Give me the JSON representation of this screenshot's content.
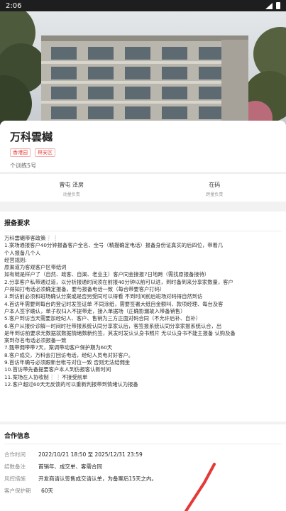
{
  "status_bar": {
    "time": "2:06"
  },
  "project": {
    "title": "万科雲樾",
    "tags": [
      "香港园",
      "林安区"
    ],
    "address": "个训练5号"
  },
  "contacts": [
    {
      "name": "曾屯 泽房",
      "role": "动量负责"
    },
    {
      "name": "在码",
      "role": "跨量负责"
    }
  ],
  "report": {
    "title": "报备要求",
    "lines": [
      "万科雲樾带客政策❕❕",
      "1.案场通报客户40分钟报备客户全名、全号（精描确定电话）报备身份证真实的后四位，带着几",
      "个人报备几个人",
      "经营规则:",
      "原渠道为客观客户区带结词",
      "如有链是样户了（自然、政客、自渠、老业主）客户同金接报7日地跨（需找原报备接待）",
      "2.分享客户私带通过道，以分析报通时间须在前报40分钟以前可以进，到时备到来分享家数量，客户",
      "户得知打电话必须确定报备，要与报备电话一致（每合带要客户打码）",
      "3.到访前必须和班场确认分案或是否另受同可以得看 不到时间前后班场对码得自然到访",
      "4.首访年需要到每台的登记时发签证单 不同涂纸，需要签署大纸自金额叫、款项经理、每台及客",
      "户本人签字确认，单子权归入不提带走，接入单据场（正确影漏故入带备销售）",
      "5.客户到访当天需要加经纪人、客户、售销为三方正面对码合同（不允许后补、自补）",
      "6.客户从报价诊解一时间时社带报系统认同分享家认后，客签报系统认同分享家报系统认合，出",
      "是年到访前要求无数据就数据情绪数新约签，其发时发认认身书照片 无以认身书不能主报备 认购及备",
      "案到存名电话必须报备一致",
      "7.甄带佣带带7天，案调带动客户保护期为60天",
      "8.客户成交，万科会打回访电话，经纪人员电对好客户。",
      "9.首访年确号必须跟新台帐号对位一致 否则无法结佣金",
      "10.首访带先备提要客户本人到仿报客认新时间",
      "11.案场在人协收制❕❕不接受前单",
      "12.客户超过60天无反馈的可以重新判报带到情绪认为报备"
    ]
  },
  "cooperation": {
    "title": "合作信息",
    "rows": [
      {
        "key": "合作时间",
        "value": "2022/10/21 18:50 至 2025/12/31 23:59"
      },
      {
        "key": "结数备注",
        "value": "首销年、成交单、客需合同"
      },
      {
        "key": "风控措施",
        "value": "开发商请认签售成交请认单，为备案后15天之内。"
      },
      {
        "key": "客户保护期",
        "value": "60天"
      }
    ]
  },
  "colors": {
    "tag_red": "#e53935",
    "status_bar": "#1e1e1e",
    "annotation_red": "#e53935"
  }
}
